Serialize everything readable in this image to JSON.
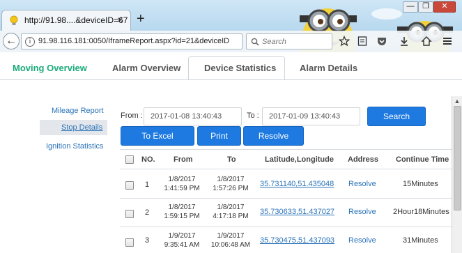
{
  "browser": {
    "tab_title": "http://91.98....&deviceID=67",
    "tab_close": "×",
    "new_tab": "+",
    "window_controls": {
      "minimize": "—",
      "restore": "❐",
      "close": "✕"
    },
    "address_url": "91.98.116.181:0050/IframeReport.aspx?id=21&deviceID",
    "search_placeholder": "Search",
    "back_glyph": "←",
    "info_glyph": "i",
    "toolbar_icons": [
      "star-icon",
      "reading-list-icon",
      "pocket-icon",
      "download-icon",
      "home-icon",
      "menu-icon"
    ]
  },
  "page_tabs": {
    "moving": "Moving Overview",
    "alarm": "Alarm Overview",
    "device": "Device Statistics",
    "details": "Alarm Details"
  },
  "sidebar": {
    "mileage": "Mileage Report",
    "stop": "Stop Details",
    "ignition": "Ignition Statistics"
  },
  "filter": {
    "from_label": "From :",
    "from_value": "2017-01-08 13:40:43",
    "to_label": "To :",
    "to_value": "2017-01-09 13:40:43",
    "search": "Search",
    "excel": "To Excel",
    "print": "Print",
    "resolve": "Resolve"
  },
  "table": {
    "headers": [
      "NO.",
      "From",
      "To",
      "Latitude,Longitude",
      "Address",
      "Continue Time"
    ],
    "rows": [
      {
        "no": "1",
        "from_date": "1/8/2017",
        "from_time": "1:41:59 PM",
        "to_date": "1/8/2017",
        "to_time": "1:57:26 PM",
        "latlng": "35.731140,51.435048",
        "address": "Resolve",
        "duration": "15Minutes"
      },
      {
        "no": "2",
        "from_date": "1/8/2017",
        "from_time": "1:59:15 PM",
        "to_date": "1/8/2017",
        "to_time": "4:17:18 PM",
        "latlng": "35.730633,51.437027",
        "address": "Resolve",
        "duration": "2Hour18Minutes"
      },
      {
        "no": "3",
        "from_date": "1/9/2017",
        "from_time": "9:35:41 AM",
        "to_date": "1/9/2017",
        "to_time": "10:06:48 AM",
        "latlng": "35.730475,51.437093",
        "address": "Resolve",
        "duration": "31Minutes"
      }
    ]
  },
  "colors": {
    "accent": "#1e7ae0",
    "active_tab_text": "#1aaa7a",
    "link": "#2a73b8"
  }
}
